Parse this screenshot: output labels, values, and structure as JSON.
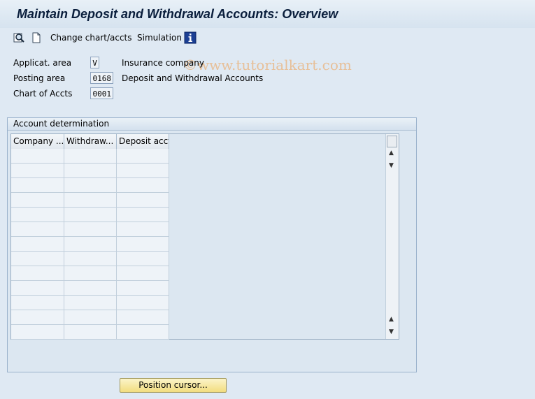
{
  "window": {
    "title": "Maintain Deposit and Withdrawal Accounts: Overview"
  },
  "toolbar": {
    "change_chart_label": "Change chart/accts",
    "simulation_label": "Simulation",
    "watermark": "©www.tutorialkart.com",
    "icons": [
      "search-display-icon",
      "new-document-icon",
      "info-icon"
    ]
  },
  "fields": {
    "applic_area": {
      "label": "Applicat. area",
      "value": "V",
      "desc": "Insurance company"
    },
    "posting_area": {
      "label": "Posting area",
      "value": "0168",
      "desc": "Deposit and Withdrawal Accounts"
    },
    "chart_of_accts": {
      "label": "Chart of Accts",
      "value": "0001"
    }
  },
  "group": {
    "title": "Account determination"
  },
  "table": {
    "columns": [
      "Company ...",
      "Withdraw...",
      "Deposit acct"
    ],
    "rows": [
      [
        "",
        "",
        ""
      ],
      [
        "",
        "",
        ""
      ],
      [
        "",
        "",
        ""
      ],
      [
        "",
        "",
        ""
      ],
      [
        "",
        "",
        ""
      ],
      [
        "",
        "",
        ""
      ],
      [
        "",
        "",
        ""
      ],
      [
        "",
        "",
        ""
      ],
      [
        "",
        "",
        ""
      ],
      [
        "",
        "",
        ""
      ],
      [
        "",
        "",
        ""
      ],
      [
        "",
        "",
        ""
      ],
      [
        "",
        "",
        ""
      ]
    ]
  },
  "buttons": {
    "position_cursor": "Position cursor..."
  },
  "colors": {
    "background": "#dfe9f3",
    "button": "#f2dd7f",
    "title": "#0a1e3c"
  }
}
